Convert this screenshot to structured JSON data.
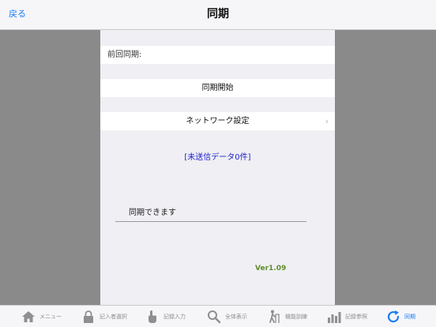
{
  "navbar": {
    "back_label": "戻る",
    "title": "同期"
  },
  "panel": {
    "last_sync_label": "前回同期:",
    "start_sync_label": "同期開始",
    "network_settings_label": "ネットワーク設定",
    "network_chevron": "›",
    "unsent_data_label": "[未送信データ0件]",
    "status_text": "同期できます",
    "version": "Ver1.09"
  },
  "tabbar": {
    "items": [
      {
        "label": "メニュー",
        "icon": "home-icon"
      },
      {
        "label": "記入者選択",
        "icon": "lock-icon"
      },
      {
        "label": "記録入力",
        "icon": "hand-pointer-icon"
      },
      {
        "label": "全体表示",
        "icon": "search-icon"
      },
      {
        "label": "機能訓練",
        "icon": "walker-icon"
      },
      {
        "label": "記録参照",
        "icon": "bar-chart-icon"
      },
      {
        "label": "同期",
        "icon": "sync-icon"
      }
    ],
    "active_index": 6
  },
  "colors": {
    "accent": "#1a7cf5",
    "unsent_text": "#2222cc",
    "version_text": "#5f8c2a",
    "side_background": "#8a8a8a",
    "panel_background": "#efeff4"
  }
}
